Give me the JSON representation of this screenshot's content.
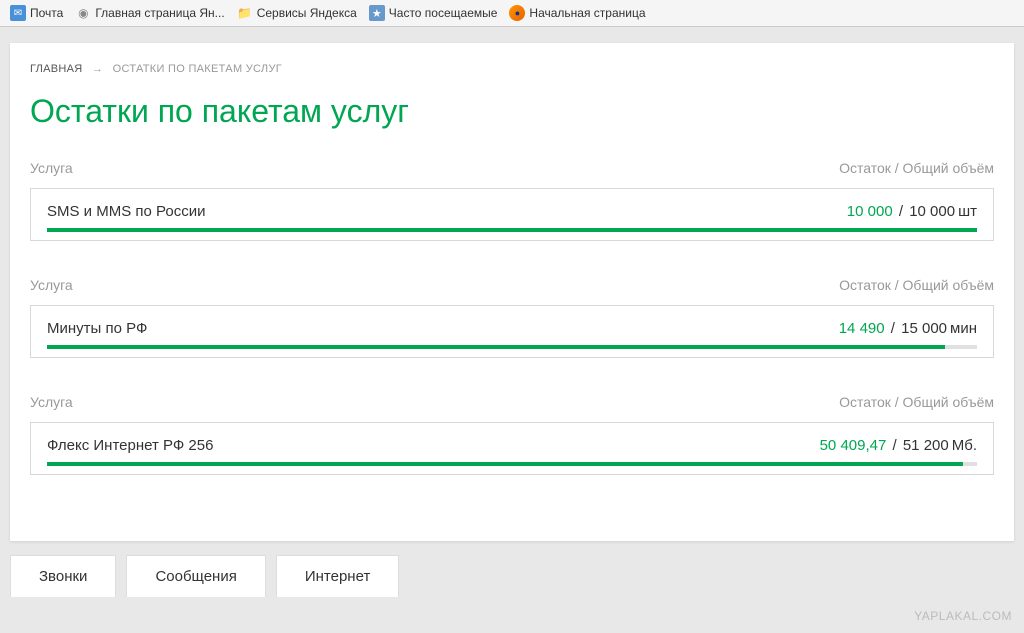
{
  "bookmarks": {
    "mail": "Почта",
    "yandex_home": "Главная страница Ян...",
    "yandex_services": "Сервисы Яндекса",
    "frequent": "Часто посещаемые",
    "start": "Начальная страница"
  },
  "breadcrumb": {
    "home": "ГЛАВНАЯ",
    "arrow": "→",
    "current": "ОСТАТКИ ПО ПАКЕТАМ УСЛУГ"
  },
  "page_title": "Остатки по пакетам услуг",
  "headers": {
    "service": "Услуга",
    "balance": "Остаток / Общий объём"
  },
  "services": [
    {
      "name": "SMS и MMS по России",
      "remain": "10 000",
      "total": "10 000",
      "unit": "шт",
      "fill_pct": 100
    },
    {
      "name": "Минуты по РФ",
      "remain": "14 490",
      "total": "15 000",
      "unit": "мин",
      "fill_pct": 96.6
    },
    {
      "name": "Флекс Интернет РФ 256",
      "remain": "50 409,47",
      "total": "51 200",
      "unit": "Мб.",
      "fill_pct": 98.5
    }
  ],
  "tabs": {
    "calls": "Звонки",
    "messages": "Сообщения",
    "internet": "Интернет"
  },
  "watermark": "YAPLAKAL.COM"
}
